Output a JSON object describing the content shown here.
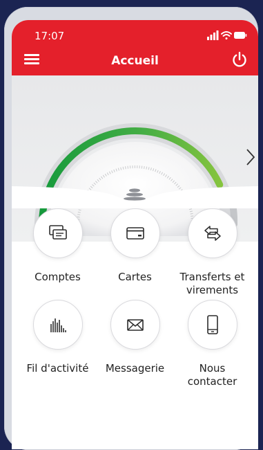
{
  "status_bar": {
    "time": "17:07"
  },
  "header": {
    "title": "Accueil"
  },
  "hero": {
    "gauge_level": 0.86
  },
  "tiles": [
    {
      "label": "Comptes",
      "icon": "cards-stack-icon"
    },
    {
      "label": "Cartes",
      "icon": "credit-card-icon"
    },
    {
      "label": "Transferts et virements",
      "icon": "transfer-arrows-icon"
    },
    {
      "label": "Fil d'activité",
      "icon": "activity-bars-icon"
    },
    {
      "label": "Messagerie",
      "icon": "envelope-icon"
    },
    {
      "label": "Nous contacter",
      "icon": "phone-icon"
    }
  ],
  "colors": {
    "brand_red": "#e4202b",
    "gauge_green": "#3aa844"
  }
}
